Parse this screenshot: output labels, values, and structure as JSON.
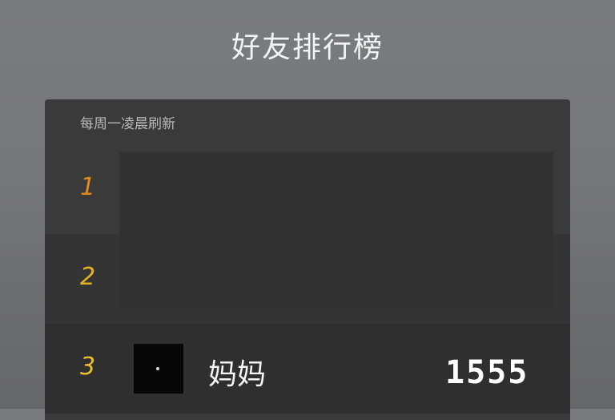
{
  "header": {
    "title": "好友排行榜"
  },
  "leaderboard": {
    "subtitle": "每周一凌晨刷新",
    "rows": [
      {
        "rank": "1",
        "name": "",
        "score": ""
      },
      {
        "rank": "2",
        "name": "",
        "score": ""
      },
      {
        "rank": "3",
        "name": "妈妈",
        "score": "1555"
      }
    ]
  },
  "colors": {
    "background": "#77787c",
    "panel": "#3a3a3b",
    "rank_1": "#e08a1a",
    "rank_2": "#e3b224",
    "rank_3": "#e9c22e",
    "text": "#ffffff"
  }
}
